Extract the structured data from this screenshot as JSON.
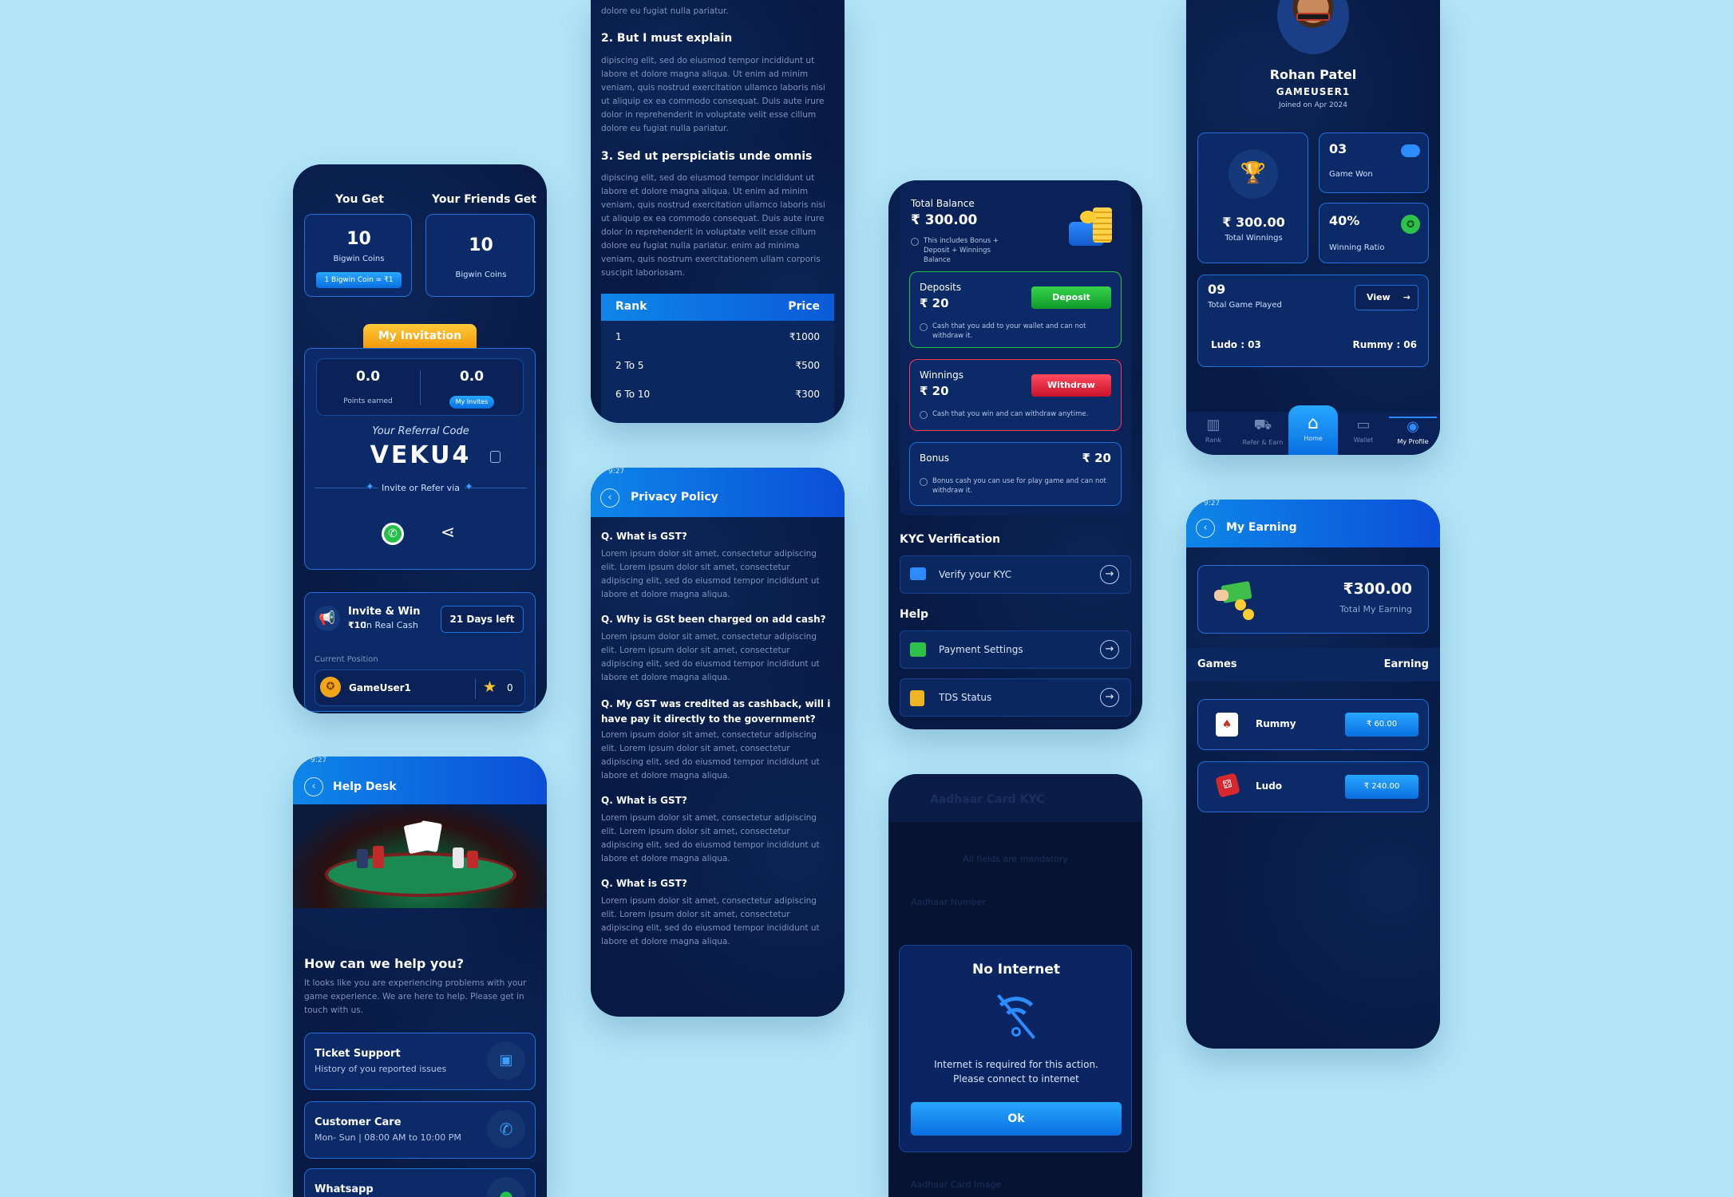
{
  "referral": {
    "you_get_title": "You Get",
    "friends_get_title": "Your Friends Get",
    "you_get_value": "10",
    "you_get_unit": "Bigwin Coins",
    "coin_rate": "1 Bigwin Coin = ₹1",
    "friends_get_value": "10",
    "friends_get_unit": "Bigwin Coins",
    "invitation_tab": "My Invitation",
    "points_value": "0.0",
    "points_label": "Points earned",
    "invites_value": "0.0",
    "invites_label": "My Invites",
    "code_label": "Your Referral Code",
    "code": "VEKU4",
    "invite_via": "Invite or Refer via",
    "invite_win_title": "Invite & Win",
    "invite_win_amount": "₹10",
    "invite_win_suffix": "in Real Cash",
    "days_left": "21 Days left",
    "current_position": "Current Position",
    "position_user": "GameUser1",
    "position_score": "0"
  },
  "help": {
    "title": "Help Desk",
    "heading": "How can we help you?",
    "desc": "It looks like you are experiencing problems with your game experience. We are here to help. Please get in touch with us.",
    "ticket_title": "Ticket Support",
    "ticket_sub": "History of you reported issues",
    "care_title": "Customer Care",
    "care_sub": "Mon- Sun | 08:00 AM to 10:00 PM",
    "whatsapp_title": "Whatsapp"
  },
  "terms": {
    "top_para_tail": "dolore eu fugiat nulla pariatur.",
    "section2_title": "2. But I must explain",
    "section2_text": "dipiscing elit, sed do eiusmod tempor incididunt ut labore et dolore magna aliqua. Ut enim ad minim veniam, quis nostrud exercitation ullamco laboris nisi ut aliquip ex ea commodo consequat. Duis aute irure dolor in reprehenderit in voluptate velit esse cillum dolore eu fugiat nulla pariatur.",
    "section3_title": "3. Sed ut perspiciatis unde omnis",
    "section3_text": "dipiscing elit, sed do eiusmod tempor incididunt ut labore et dolore magna aliqua. Ut enim ad minim veniam, quis nostrud exercitation ullamco laboris nisi ut aliquip ex ea commodo consequat. Duis aute irure dolor in reprehenderit in voluptate velit esse cillum dolore eu fugiat nulla pariatur. enim ad minima veniam, quis nostrum exercitationem ullam corporis suscipit laboriosam.",
    "table_col_rank": "Rank",
    "table_col_price": "Price",
    "rows": [
      {
        "rank": "1",
        "price": "₹1000"
      },
      {
        "rank": "2 To 5",
        "price": "₹500"
      },
      {
        "rank": "6 To 10",
        "price": "₹300"
      }
    ]
  },
  "privacy": {
    "title": "Privacy Policy",
    "lorem": "Lorem ipsum dolor sit amet, consectetur adipiscing elit. Lorem ipsum dolor sit amet, consectetur adipiscing elit, sed do eiusmod tempor incididunt ut labore et dolore magna aliqua.",
    "q1": "Q. What is GST?",
    "q2": "Q. Why is GSt been charged on add cash?",
    "q3": "Q. My GST was credited as cashback, will i have pay it directly to the government?",
    "q4": "Q. What is GST?",
    "q5": "Q. What is GST?"
  },
  "wallet": {
    "total_label": "Total Balance",
    "total_value": "₹ 300.00",
    "total_note": "This includes Bonus + Deposit + Winnings Balance",
    "deposits_label": "Deposits",
    "deposits_value": "₹ 20",
    "deposit_btn": "Deposit",
    "deposits_note": "Cash that you add to your wallet and can not withdraw it.",
    "winnings_label": "Winnings",
    "winnings_value": "₹ 20",
    "withdraw_btn": "Withdraw",
    "winnings_note": "Cash that you win and can withdraw anytime.",
    "bonus_label": "Bonus",
    "bonus_value": "₹ 20",
    "bonus_note": "Bonus cash you can use for play game and can not withdraw it.",
    "kyc_heading": "KYC Verification",
    "kyc_item": "Verify your KYC",
    "help_heading": "Help",
    "payment_item": "Payment Settings",
    "tds_item": "TDS Status"
  },
  "kyc": {
    "title": "Aadhaar Card KYC",
    "all_fields": "All fields are mandatory",
    "aadhaar_number": "Aadhaar Number",
    "aadhaar_image": "Aadhaar Card Image",
    "dialog_title": "No Internet",
    "dialog_msg1": "Internet is required for this action.",
    "dialog_msg2": "Please connect to internet",
    "ok_btn": "Ok"
  },
  "profile": {
    "name": "Rohan Patel",
    "username": "GAMEUSER1",
    "joined": "Joined on Apr 2024",
    "total_winnings_value": "₹ 300.00",
    "total_winnings_label": "Total Winnings",
    "game_won_value": "03",
    "game_won_label": "Game Won",
    "ratio_value": "40%",
    "ratio_label": "Winning Ratio",
    "played_value": "09",
    "played_label": "Total Game Played",
    "view_btn": "View",
    "ludo": "Ludo : 03",
    "rummy": "Rummy : 06",
    "nav": [
      "Rank",
      "Refer & Earn",
      "Home",
      "Wallet",
      "My Profile"
    ]
  },
  "earning": {
    "title": "My Earning",
    "total_value": "₹300.00",
    "total_label": "Total My Earning",
    "col_games": "Games",
    "col_earning": "Earning",
    "rows": [
      {
        "game": "Rummy",
        "amount": "₹ 60.00"
      },
      {
        "game": "Ludo",
        "amount": "₹ 240.00"
      }
    ]
  },
  "status_time": "9:27"
}
